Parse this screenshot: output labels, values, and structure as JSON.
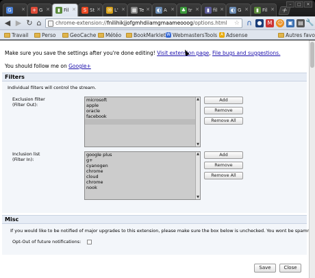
{
  "tabs": [
    {
      "title": "G",
      "icon": "google-favicon",
      "color": "#4a7fd4"
    },
    {
      "title": "G",
      "icon": "google-plus-favicon",
      "color": "#dd4b39"
    },
    {
      "title": "Fil",
      "icon": "filter-favicon",
      "color": "#5a8a3a",
      "active": true
    },
    {
      "title": "St",
      "icon": "stumble-favicon",
      "color": "#eb4924"
    },
    {
      "title": "L'",
      "icon": "mail-favicon",
      "color": "#d8a21b"
    },
    {
      "title": "Te",
      "icon": "image-favicon",
      "color": "#888888"
    },
    {
      "title": "A",
      "icon": "globe-favicon",
      "color": "#6b8cb5"
    },
    {
      "title": "tr",
      "icon": "leaf-favicon",
      "color": "#3c9a3c"
    },
    {
      "title": "fil",
      "icon": "filter-favicon-2",
      "color": "#5c5c9a"
    },
    {
      "title": "G",
      "icon": "globe-favicon-2",
      "color": "#6b8cb5"
    },
    {
      "title": "Fil",
      "icon": "filter-favicon-3",
      "color": "#5a8a3a"
    }
  ],
  "toolbar": {
    "url_scheme": "chrome-extension://",
    "url_host": "fnilihikjjofgmhdiiamgmaameooog",
    "url_path": "/options.html"
  },
  "bookmarks": [
    {
      "label": "Travail",
      "type": "folder"
    },
    {
      "label": "Perso",
      "type": "folder"
    },
    {
      "label": "GeoCache",
      "type": "folder"
    },
    {
      "label": "Météo",
      "type": "folder"
    },
    {
      "label": "BookMarklets",
      "type": "folder"
    },
    {
      "label": "WebmastersTools",
      "type": "site",
      "color": "#3367d6"
    },
    {
      "label": "Adsense",
      "type": "site",
      "color": "#e8a800"
    },
    {
      "label": "Autres favoris",
      "type": "folder"
    }
  ],
  "page": {
    "intro_text": "Make sure you save the settings after you're done editing!",
    "link_extension": "Visit extension page",
    "link_bugs": "File bugs and suggestions.",
    "follow_text": "You should follow me on",
    "follow_link": "Google+",
    "filters": {
      "title": "Filters",
      "description": "Individual filters will control the stream.",
      "exclusion_label_1": "Exclusion filter",
      "exclusion_label_2": "(Filter Out):",
      "exclusion_items": [
        "microsoft",
        "apple",
        "oracle",
        "facebook"
      ],
      "inclusion_label_1": "Inclusion list",
      "inclusion_label_2": "(Filter In):",
      "inclusion_items": [
        "google plus",
        "g+",
        "cyanogen",
        "chrome",
        "cloud",
        "chrome",
        "nook"
      ],
      "add": "Add",
      "remove": "Remove",
      "remove_all": "Remove All"
    },
    "misc": {
      "title": "Misc",
      "description": "If you would like to be notified of major upgrades to this extension, please make sure the box below is unchecked. You wont be spammed.",
      "optout_label": "Opt-Out of future notifications:"
    },
    "save": "Save",
    "close": "Close"
  }
}
